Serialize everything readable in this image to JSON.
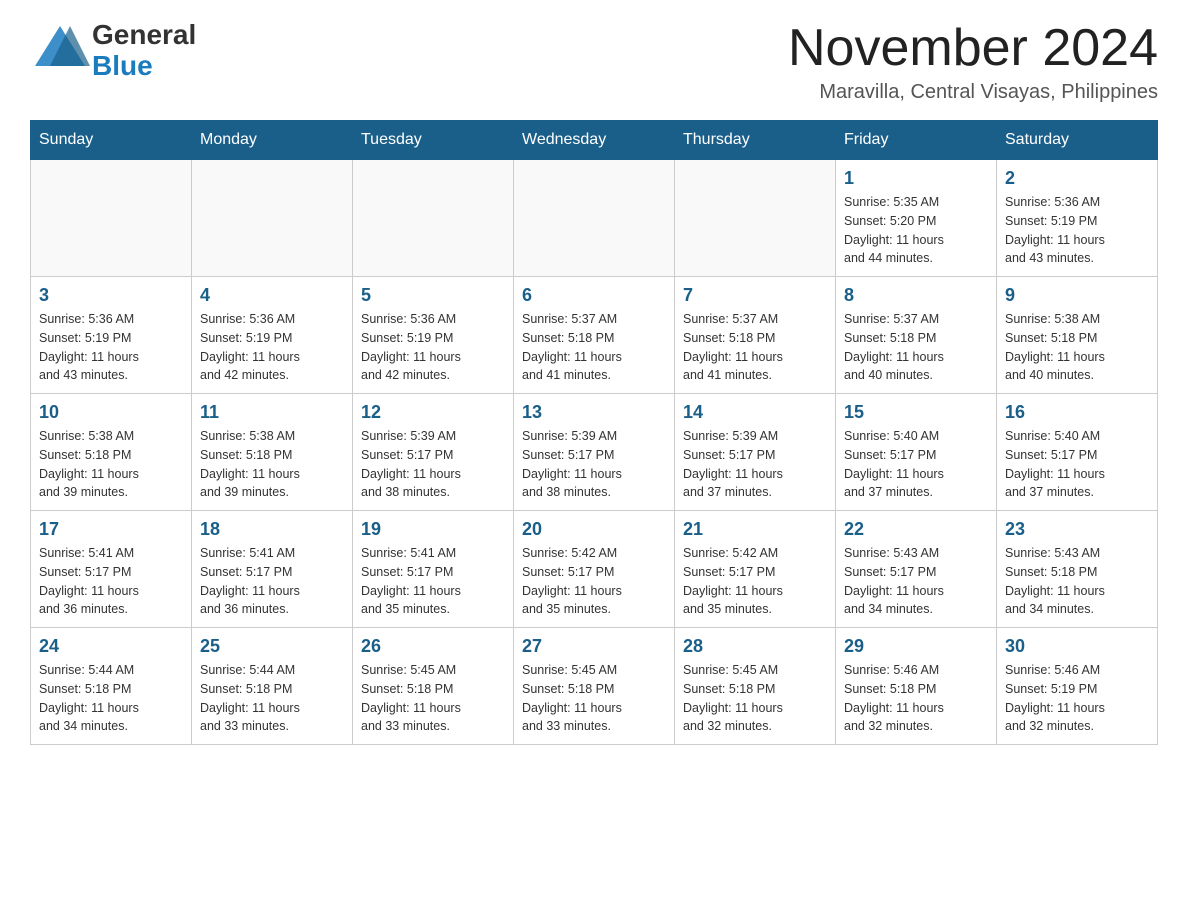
{
  "header": {
    "logo_general": "General",
    "logo_blue": "Blue",
    "month_title": "November 2024",
    "location": "Maravilla, Central Visayas, Philippines"
  },
  "calendar": {
    "days_of_week": [
      "Sunday",
      "Monday",
      "Tuesday",
      "Wednesday",
      "Thursday",
      "Friday",
      "Saturday"
    ],
    "weeks": [
      {
        "days": [
          {
            "empty": true
          },
          {
            "empty": true
          },
          {
            "empty": true
          },
          {
            "empty": true
          },
          {
            "empty": true
          },
          {
            "date": 1,
            "sunrise": "5:35 AM",
            "sunset": "5:20 PM",
            "daylight": "11 hours and 44 minutes."
          },
          {
            "date": 2,
            "sunrise": "5:36 AM",
            "sunset": "5:19 PM",
            "daylight": "11 hours and 43 minutes."
          }
        ]
      },
      {
        "days": [
          {
            "date": 3,
            "sunrise": "5:36 AM",
            "sunset": "5:19 PM",
            "daylight": "11 hours and 43 minutes."
          },
          {
            "date": 4,
            "sunrise": "5:36 AM",
            "sunset": "5:19 PM",
            "daylight": "11 hours and 42 minutes."
          },
          {
            "date": 5,
            "sunrise": "5:36 AM",
            "sunset": "5:19 PM",
            "daylight": "11 hours and 42 minutes."
          },
          {
            "date": 6,
            "sunrise": "5:37 AM",
            "sunset": "5:18 PM",
            "daylight": "11 hours and 41 minutes."
          },
          {
            "date": 7,
            "sunrise": "5:37 AM",
            "sunset": "5:18 PM",
            "daylight": "11 hours and 41 minutes."
          },
          {
            "date": 8,
            "sunrise": "5:37 AM",
            "sunset": "5:18 PM",
            "daylight": "11 hours and 40 minutes."
          },
          {
            "date": 9,
            "sunrise": "5:38 AM",
            "sunset": "5:18 PM",
            "daylight": "11 hours and 40 minutes."
          }
        ]
      },
      {
        "days": [
          {
            "date": 10,
            "sunrise": "5:38 AM",
            "sunset": "5:18 PM",
            "daylight": "11 hours and 39 minutes."
          },
          {
            "date": 11,
            "sunrise": "5:38 AM",
            "sunset": "5:18 PM",
            "daylight": "11 hours and 39 minutes."
          },
          {
            "date": 12,
            "sunrise": "5:39 AM",
            "sunset": "5:17 PM",
            "daylight": "11 hours and 38 minutes."
          },
          {
            "date": 13,
            "sunrise": "5:39 AM",
            "sunset": "5:17 PM",
            "daylight": "11 hours and 38 minutes."
          },
          {
            "date": 14,
            "sunrise": "5:39 AM",
            "sunset": "5:17 PM",
            "daylight": "11 hours and 37 minutes."
          },
          {
            "date": 15,
            "sunrise": "5:40 AM",
            "sunset": "5:17 PM",
            "daylight": "11 hours and 37 minutes."
          },
          {
            "date": 16,
            "sunrise": "5:40 AM",
            "sunset": "5:17 PM",
            "daylight": "11 hours and 37 minutes."
          }
        ]
      },
      {
        "days": [
          {
            "date": 17,
            "sunrise": "5:41 AM",
            "sunset": "5:17 PM",
            "daylight": "11 hours and 36 minutes."
          },
          {
            "date": 18,
            "sunrise": "5:41 AM",
            "sunset": "5:17 PM",
            "daylight": "11 hours and 36 minutes."
          },
          {
            "date": 19,
            "sunrise": "5:41 AM",
            "sunset": "5:17 PM",
            "daylight": "11 hours and 35 minutes."
          },
          {
            "date": 20,
            "sunrise": "5:42 AM",
            "sunset": "5:17 PM",
            "daylight": "11 hours and 35 minutes."
          },
          {
            "date": 21,
            "sunrise": "5:42 AM",
            "sunset": "5:17 PM",
            "daylight": "11 hours and 35 minutes."
          },
          {
            "date": 22,
            "sunrise": "5:43 AM",
            "sunset": "5:17 PM",
            "daylight": "11 hours and 34 minutes."
          },
          {
            "date": 23,
            "sunrise": "5:43 AM",
            "sunset": "5:18 PM",
            "daylight": "11 hours and 34 minutes."
          }
        ]
      },
      {
        "days": [
          {
            "date": 24,
            "sunrise": "5:44 AM",
            "sunset": "5:18 PM",
            "daylight": "11 hours and 34 minutes."
          },
          {
            "date": 25,
            "sunrise": "5:44 AM",
            "sunset": "5:18 PM",
            "daylight": "11 hours and 33 minutes."
          },
          {
            "date": 26,
            "sunrise": "5:45 AM",
            "sunset": "5:18 PM",
            "daylight": "11 hours and 33 minutes."
          },
          {
            "date": 27,
            "sunrise": "5:45 AM",
            "sunset": "5:18 PM",
            "daylight": "11 hours and 33 minutes."
          },
          {
            "date": 28,
            "sunrise": "5:45 AM",
            "sunset": "5:18 PM",
            "daylight": "11 hours and 32 minutes."
          },
          {
            "date": 29,
            "sunrise": "5:46 AM",
            "sunset": "5:18 PM",
            "daylight": "11 hours and 32 minutes."
          },
          {
            "date": 30,
            "sunrise": "5:46 AM",
            "sunset": "5:19 PM",
            "daylight": "11 hours and 32 minutes."
          }
        ]
      }
    ],
    "labels": {
      "sunrise": "Sunrise:",
      "sunset": "Sunset:",
      "daylight": "Daylight:"
    }
  }
}
